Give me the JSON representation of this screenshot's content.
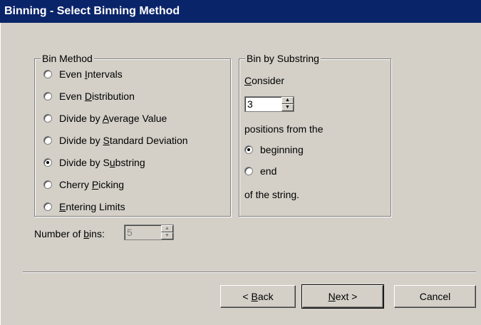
{
  "window": {
    "title": "Binning - Select Binning Method"
  },
  "bin_method": {
    "legend": "Bin Method",
    "options": [
      {
        "pre": "Even ",
        "key": "I",
        "post": "ntervals",
        "checked": false
      },
      {
        "pre": "Even ",
        "key": "D",
        "post": "istribution",
        "checked": false
      },
      {
        "pre": "Divide by ",
        "key": "A",
        "post": "verage Value",
        "checked": false
      },
      {
        "pre": "Divide by ",
        "key": "S",
        "post": "tandard Deviation",
        "checked": false
      },
      {
        "pre": "Divide by S",
        "key": "u",
        "post": "bstring",
        "checked": true
      },
      {
        "pre": "Cherry ",
        "key": "P",
        "post": "icking",
        "checked": false
      },
      {
        "pre": "",
        "key": "E",
        "post": "ntering Limits",
        "checked": false
      }
    ]
  },
  "bin_by_substring": {
    "legend": "Bin by Substring",
    "consider_key": "C",
    "consider_rest": "onsider",
    "positions_value": "3",
    "positions_text": "positions from the",
    "beginning_label": "beginning",
    "end_label": "end",
    "of_string_text": "of the string.",
    "beginning_checked": true
  },
  "number_of_bins": {
    "pre": "Number of ",
    "key": "b",
    "post": "ins:",
    "value": "5"
  },
  "buttons": {
    "back": {
      "pre": "< ",
      "key": "B",
      "post": "ack"
    },
    "next": {
      "pre": "",
      "key": "N",
      "post": "ext >"
    },
    "cancel": "Cancel"
  }
}
